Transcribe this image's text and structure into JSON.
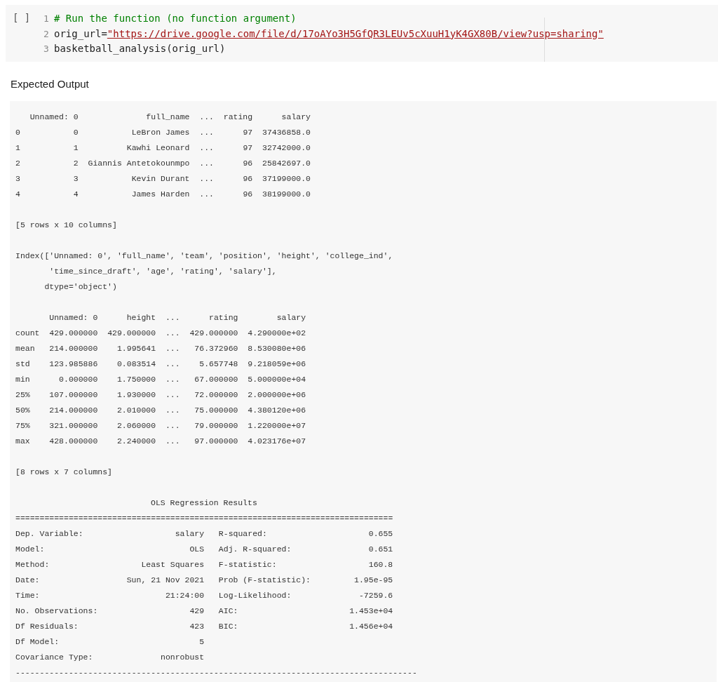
{
  "code_cell": {
    "run_indicator": "[ ]",
    "lines": [
      {
        "number": "1",
        "tokens": [
          {
            "kind": "comment",
            "text": "# Run the function (no function argument)"
          }
        ]
      },
      {
        "number": "2",
        "tokens": [
          {
            "kind": "plain",
            "text": "orig_url="
          },
          {
            "kind": "link",
            "text": "\"https://drive.google.com/file/d/17oAYo3H5GfQR3LEUv5cXuuH1yK4GX80B/view?usp=sharing\""
          }
        ]
      },
      {
        "number": "3",
        "tokens": [
          {
            "kind": "plain",
            "text": "basketball_analysis(orig_url)"
          }
        ]
      }
    ]
  },
  "output_label": "Expected Output",
  "output": {
    "head_table": {
      "columns": [
        "",
        "Unnamed: 0",
        "full_name",
        "...",
        "rating",
        "salary"
      ],
      "rows": [
        [
          "0",
          "0",
          "LeBron James",
          "...",
          "97",
          "37436858.0"
        ],
        [
          "1",
          "1",
          "Kawhi Leonard",
          "...",
          "97",
          "32742000.0"
        ],
        [
          "2",
          "2",
          "Giannis Antetokounmpo",
          "...",
          "96",
          "25842697.0"
        ],
        [
          "3",
          "3",
          "Kevin Durant",
          "...",
          "96",
          "37199000.0"
        ],
        [
          "4",
          "4",
          "James Harden",
          "...",
          "96",
          "38199000.0"
        ]
      ]
    },
    "head_shape": "[5 rows x 10 columns]",
    "index_lines": [
      "Index(['Unnamed: 0', 'full_name', 'team', 'position', 'height', 'college_ind',",
      "       'time_since_draft', 'age', 'rating', 'salary'],",
      "      dtype='object')"
    ],
    "describe_table": {
      "columns": [
        "",
        "Unnamed: 0",
        "height",
        "...",
        "rating",
        "salary"
      ],
      "rows": [
        [
          "count",
          "429.000000",
          "429.000000",
          "...",
          "429.000000",
          "4.290000e+02"
        ],
        [
          "mean",
          "214.000000",
          "1.995641",
          "...",
          "76.372960",
          "8.530080e+06"
        ],
        [
          "std",
          "123.985886",
          "0.083514",
          "...",
          "5.657748",
          "9.218059e+06"
        ],
        [
          "min",
          "0.000000",
          "1.750000",
          "...",
          "67.000000",
          "5.000000e+04"
        ],
        [
          "25%",
          "107.000000",
          "1.930000",
          "...",
          "72.000000",
          "2.000000e+06"
        ],
        [
          "50%",
          "214.000000",
          "2.010000",
          "...",
          "75.000000",
          "4.380120e+06"
        ],
        [
          "75%",
          "321.000000",
          "2.060000",
          "...",
          "79.000000",
          "1.220000e+07"
        ],
        [
          "max",
          "428.000000",
          "2.240000",
          "...",
          "97.000000",
          "4.023176e+07"
        ]
      ]
    },
    "describe_shape": "[8 rows x 7 columns]",
    "ols": {
      "title": "OLS Regression Results",
      "top_rule": "==============================================================================",
      "rows": [
        [
          "Dep. Variable:",
          "salary",
          "R-squared:",
          "0.655"
        ],
        [
          "Model:",
          "OLS",
          "Adj. R-squared:",
          "0.651"
        ],
        [
          "Method:",
          "Least Squares",
          "F-statistic:",
          "160.8"
        ],
        [
          "Date:",
          "Sun, 21 Nov 2021",
          "Prob (F-statistic):",
          "1.95e-95"
        ],
        [
          "Time:",
          "21:24:00",
          "Log-Likelihood:",
          "-7259.6"
        ],
        [
          "No. Observations:",
          "429",
          "AIC:",
          "1.453e+04"
        ],
        [
          "Df Residuals:",
          "423",
          "BIC:",
          "1.456e+04"
        ],
        [
          "Df Model:",
          "5"
        ],
        [
          "Covariance Type:",
          "nonrobust"
        ]
      ],
      "bottom_rule": "-----------------------------------------------------------------------------------"
    }
  }
}
